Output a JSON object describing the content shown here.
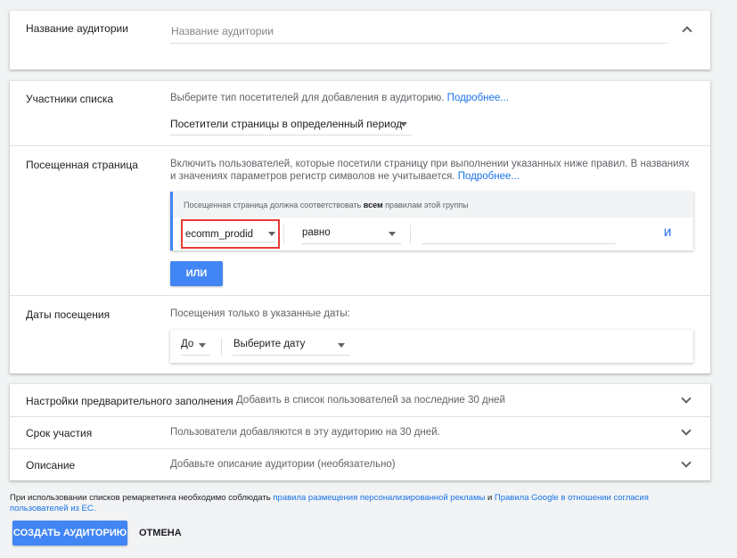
{
  "name_section": {
    "label": "Название аудитории",
    "input_placeholder": "Название аудитории"
  },
  "members": {
    "label": "Участники списка",
    "description": "Выберите тип посетителей для добавления в аудиторию.",
    "more_link": "Подробнее...",
    "selected_type": "Посетители страницы в определенный период"
  },
  "visited_page": {
    "label": "Посещенная страница",
    "description_line1": "Включить пользователей, которые посетили страницу при выполнении указанных ниже правил. В названиях",
    "description_line2": "и значениях параметров регистр символов не учитывается.",
    "more_link": "Подробнее...",
    "group_header": "Посещенная страница должна соответствовать всем правилам этой группы",
    "rule_param": "ecomm_prodid",
    "rule_operator": "равно",
    "rule_value": "",
    "and_label": "И",
    "or_button": "ИЛИ"
  },
  "visit_dates": {
    "label": "Даты посещения",
    "description": "Посещения только в указанные даты:",
    "range_select": "До",
    "date_select": "Выберите дату"
  },
  "prefill": {
    "label": "Настройки предварительного заполнения",
    "value": "Добавить в список пользователей за последние 30 дней"
  },
  "duration": {
    "label": "Срок участия",
    "value": "Пользователи добавляются в эту аудиторию на 30 дней."
  },
  "description_row": {
    "label": "Описание",
    "value": "Добавьте описание аудитории (необязательно)"
  },
  "footer": {
    "notice_prefix": "При использовании списков ремаркетинга необходимо соблюдать",
    "link1": "правила размещения персонализированной рекламы",
    "notice_and": "и",
    "link2": "Правила Google в отношении согласия пользователей из ЕС.",
    "create_button": "СОЗДАТЬ АУДИТОРИЮ",
    "cancel_button": "ОТМЕНА"
  },
  "colors": {
    "accent": "#4285f4",
    "link": "#1a73e8",
    "highlight": "#e53935",
    "background": "#f1f3f4"
  }
}
